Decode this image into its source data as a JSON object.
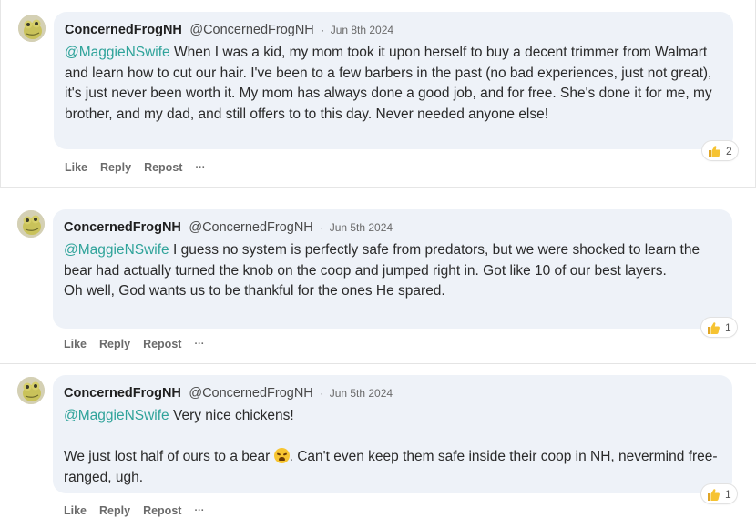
{
  "comments": [
    {
      "author": "ConcernedFrogNH",
      "handle": "@ConcernedFrogNH",
      "separator": "·",
      "date": "Jun 8th 2024",
      "mention": "@MaggieNSwife",
      "text": "When I was a kid, my mom took it upon herself to buy a decent trimmer from Walmart and learn how to cut our hair. I've been to a few barbers in the past (no bad experiences, just not great), it's just never been worth it. My mom has always done a good job, and for free. She's done it for me, my brother, and my dad, and still offers to to this day. Never needed anyone else!",
      "reaction_icon": "thumbs-up-icon",
      "reaction_count": "2",
      "actions": {
        "like": "Like",
        "reply": "Reply",
        "repost": "Repost",
        "more": "···"
      }
    },
    {
      "author": "ConcernedFrogNH",
      "handle": "@ConcernedFrogNH",
      "separator": "·",
      "date": "Jun 5th 2024",
      "mention": "@MaggieNSwife",
      "text": "I guess no system is perfectly safe from predators, but we were shocked to learn the bear had actually turned the knob on the coop and jumped right in. Got like 10 of our best layers.",
      "text2": "Oh well, God wants us to be thankful for the ones He spared.",
      "reaction_icon": "thumbs-up-icon",
      "reaction_count": "1",
      "actions": {
        "like": "Like",
        "reply": "Reply",
        "repost": "Repost",
        "more": "···"
      }
    },
    {
      "author": "ConcernedFrogNH",
      "handle": "@ConcernedFrogNH",
      "separator": "·",
      "date": "Jun 5th 2024",
      "mention": "@MaggieNSwife",
      "text": "Very nice chickens!",
      "text2a": "We just lost half of ours to a bear",
      "emoji": "angry-face-emoji",
      "text2b": ". Can't even keep them safe inside their coop in NH, nevermind free-ranged, ugh.",
      "reaction_icon": "thumbs-up-icon",
      "reaction_count": "1",
      "actions": {
        "like": "Like",
        "reply": "Reply",
        "repost": "Repost",
        "more": "···"
      }
    }
  ],
  "colors": {
    "mention": "#2fa39a",
    "bubble": "#eef2f8",
    "avatar_frog": "#c9c25a"
  }
}
